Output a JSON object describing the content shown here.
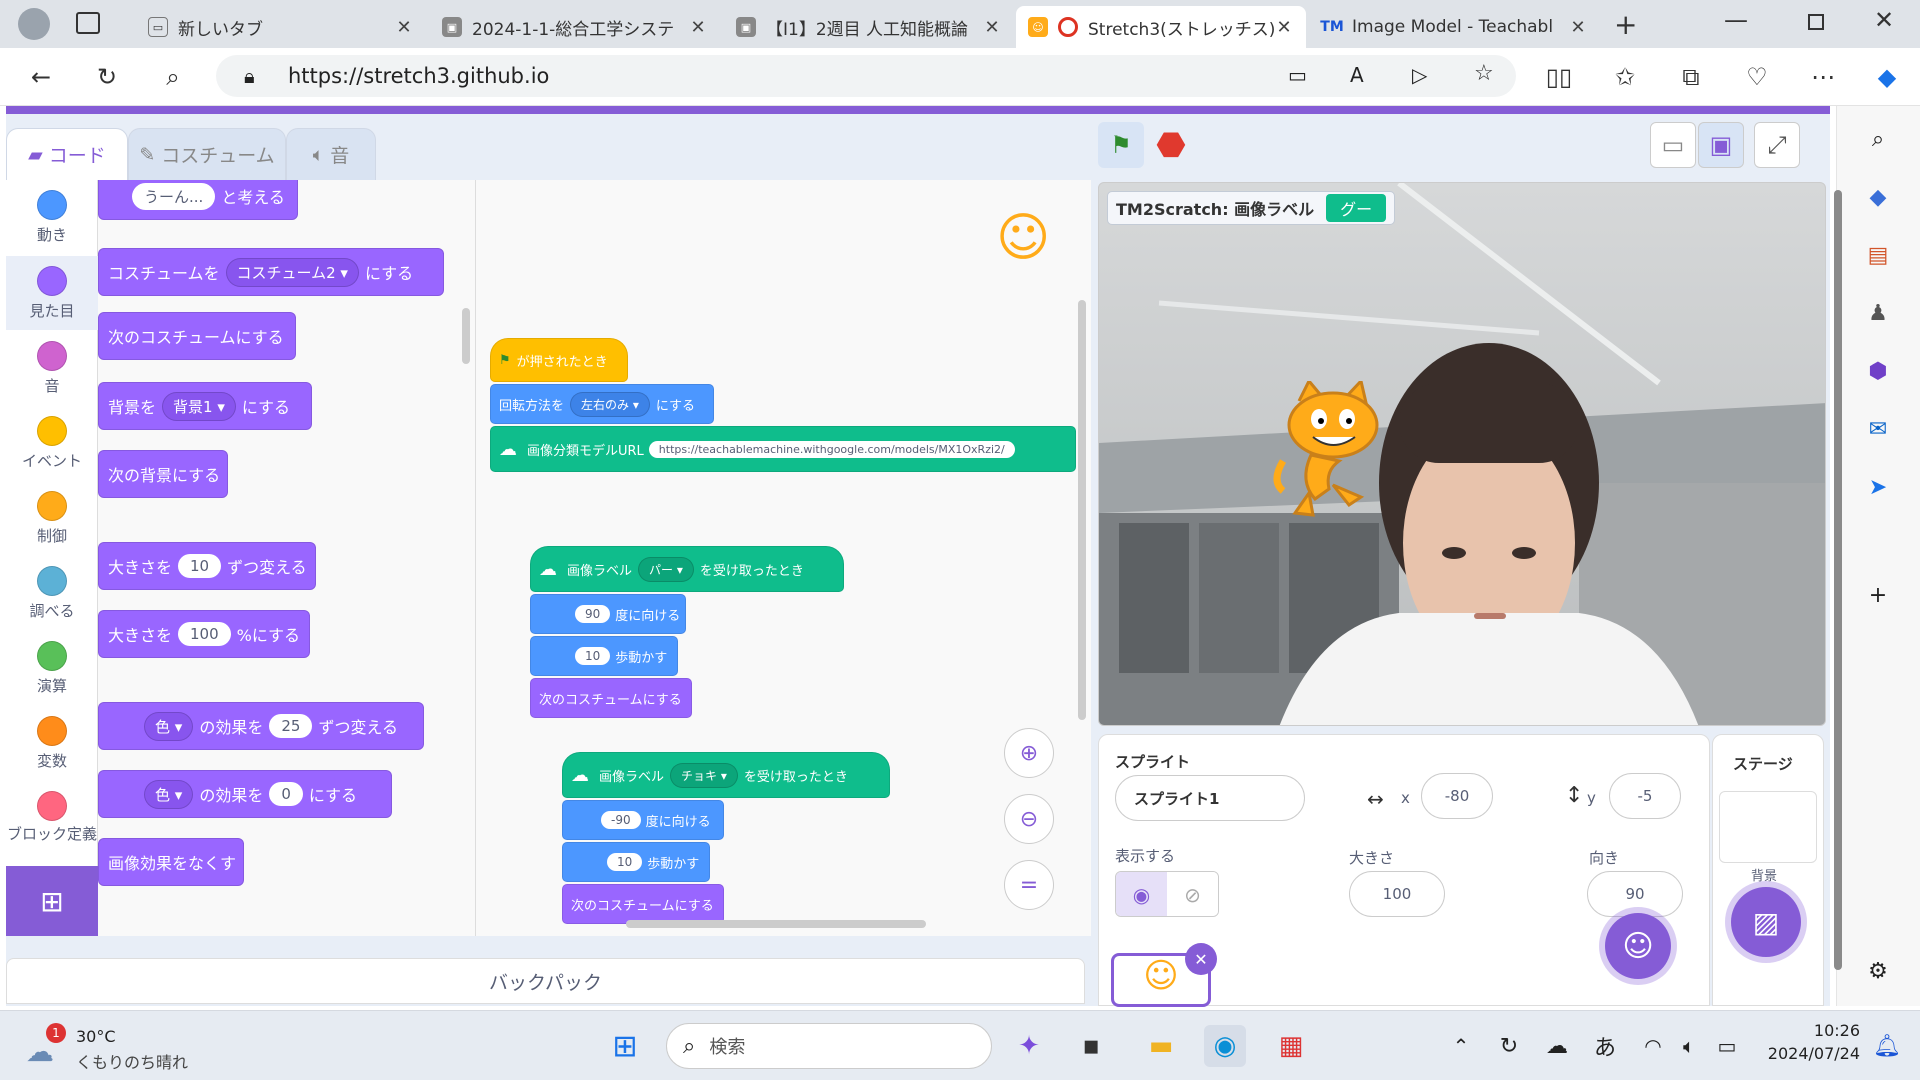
{
  "browser": {
    "tabs": [
      {
        "title": "新しいタブ",
        "active": false
      },
      {
        "title": "2024-1-1-総合工学システ",
        "active": false
      },
      {
        "title": "【I1】2週目 人工知能概論",
        "active": false
      },
      {
        "title": "Stretch3(ストレッチス)",
        "active": true
      },
      {
        "title": "Image Model - Teachabl",
        "active": false
      }
    ],
    "url": "https://stretch3.github.io"
  },
  "editor": {
    "tabs": {
      "code": "コード",
      "costume": "コスチューム",
      "sound": "音"
    },
    "categories": [
      {
        "label": "動き",
        "color": "#4c97ff"
      },
      {
        "label": "見た目",
        "color": "#9966ff"
      },
      {
        "label": "音",
        "color": "#cf63cf"
      },
      {
        "label": "イベント",
        "color": "#ffbf00"
      },
      {
        "label": "制御",
        "color": "#ffab19"
      },
      {
        "label": "調べる",
        "color": "#5cb1d6"
      },
      {
        "label": "演算",
        "color": "#59c059"
      },
      {
        "label": "変数",
        "color": "#ff8c1a"
      },
      {
        "label": "ブロック定義",
        "color": "#ff6680"
      }
    ],
    "palette": {
      "think": {
        "input": "うーん...",
        "text": "と考える"
      },
      "switch_costume": {
        "pre": "コスチュームを",
        "dd": "コスチューム2",
        "post": "にする"
      },
      "next_costume": "次のコスチュームにする",
      "switch_backdrop": {
        "pre": "背景を",
        "dd": "背景1",
        "post": "にする"
      },
      "next_backdrop": "次の背景にする",
      "change_size": {
        "pre": "大きさを",
        "val": "10",
        "post": "ずつ変える"
      },
      "set_size": {
        "pre": "大きさを",
        "val": "100",
        "post": "%にする"
      },
      "change_effect": {
        "dd": "色",
        "mid": "の効果を",
        "val": "25",
        "post": "ずつ変える"
      },
      "set_effect": {
        "dd": "色",
        "mid": "の効果を",
        "val": "0",
        "post": "にする"
      },
      "clear_effects": "画像効果をなくす"
    },
    "script": {
      "hat": "が押されたとき",
      "rotation": {
        "pre": "回転方法を",
        "dd": "左右のみ",
        "post": "にする"
      },
      "model_url": {
        "label": "画像分類モデルURL",
        "value": "https://teachablemachine.withgoogle.com/models/MX1OxRzi2/"
      },
      "ev1": {
        "label": "画像ラベル",
        "dd": "パー",
        "post": "を受け取ったとき"
      },
      "ev1_dir": {
        "val": "90",
        "post": "度に向ける"
      },
      "ev1_move": {
        "val": "10",
        "post": "歩動かす"
      },
      "ev1_next": "次のコスチュームにする",
      "ev2": {
        "label": "画像ラベル",
        "dd": "チョキ",
        "post": "を受け取ったとき"
      },
      "ev2_dir": {
        "val": "-90",
        "post": "度に向ける"
      },
      "ev2_move": {
        "val": "10",
        "post": "歩動かす"
      },
      "ev2_next": "次のコスチュームにする"
    },
    "backpack": "バックパック"
  },
  "stage": {
    "monitor": {
      "label": "TM2Scratch: 画像ラベル",
      "value": "グー"
    }
  },
  "sprite": {
    "title": "スプライト",
    "name": "スプライト1",
    "x_label": "x",
    "x": "-80",
    "y_label": "y",
    "y": "-5",
    "show_label": "表示する",
    "size_label": "大きさ",
    "size": "100",
    "dir_label": "向き",
    "direction": "90"
  },
  "stagepanel": {
    "title": "ステージ",
    "backdrop_label": "背景"
  },
  "taskbar": {
    "weather_temp": "30°C",
    "weather_desc": "くもりのち晴れ",
    "weather_badge": "1",
    "search": "検索",
    "ime": "あ",
    "time": "10:26",
    "date": "2024/07/24"
  }
}
